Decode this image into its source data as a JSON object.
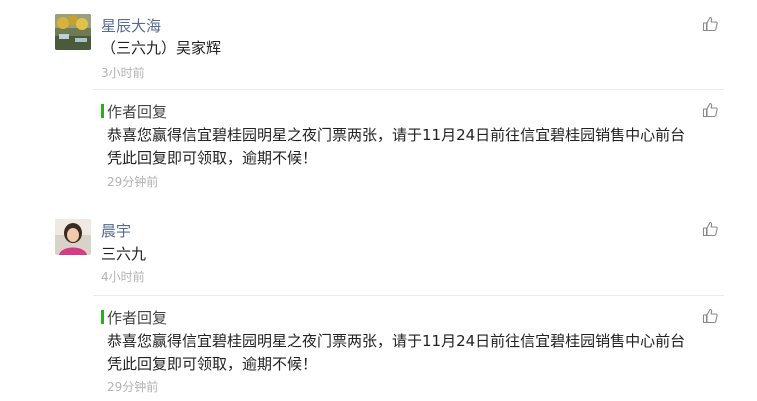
{
  "comments": [
    {
      "user": "星辰大海",
      "text": "（三六九）吴家辉",
      "time": "3小时前",
      "reply": {
        "label": "作者回复",
        "lines": [
          "恭喜您赢得信宜碧桂园明星之夜门票两张，请于11月24日前往信宜碧桂园销售中心前台",
          "凭此回复即可领取，逾期不候！"
        ],
        "time": "29分钟前"
      }
    },
    {
      "user": "晨宇",
      "text": "三六九",
      "time": "4小时前",
      "reply": {
        "label": "作者回复",
        "lines": [
          "恭喜您赢得信宜碧桂园明星之夜门票两张，请于11月24日前往信宜碧桂园销售中心前台",
          "凭此回复即可领取，逾期不候！"
        ],
        "time": "29分钟前"
      }
    }
  ],
  "icons": {
    "like": "thumbs-up-icon"
  },
  "colors": {
    "reply_accent": "#2aae1c",
    "username": "#576b95",
    "time": "#b2b2b2"
  }
}
